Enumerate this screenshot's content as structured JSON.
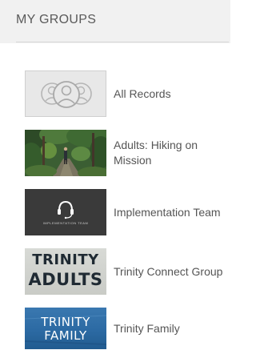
{
  "panel": {
    "title": "MY GROUPS"
  },
  "groups": [
    {
      "label": "All Records",
      "thumbnail": "people-outline-icon"
    },
    {
      "label": "Adults: Hiking on Mission",
      "thumbnail": "forest-trail-photo"
    },
    {
      "label": "Implementation Team",
      "thumbnail": "headset-icon",
      "thumbnail_caption": "IMPLEMENTATION TEAM"
    },
    {
      "label": "Trinity Connect Group",
      "thumbnail": "trinity-adults-banner",
      "thumbnail_text": [
        "TRINITY",
        "ADULTS"
      ]
    },
    {
      "label": "Trinity Family",
      "thumbnail": "trinity-family-banner",
      "thumbnail_text": [
        "TRINITY",
        "FAMILY"
      ]
    }
  ],
  "colors": {
    "header_bg": "#f1f1f1",
    "text": "#555555",
    "divider": "#d6d6d6",
    "family_blue": "#2c6aa3"
  }
}
